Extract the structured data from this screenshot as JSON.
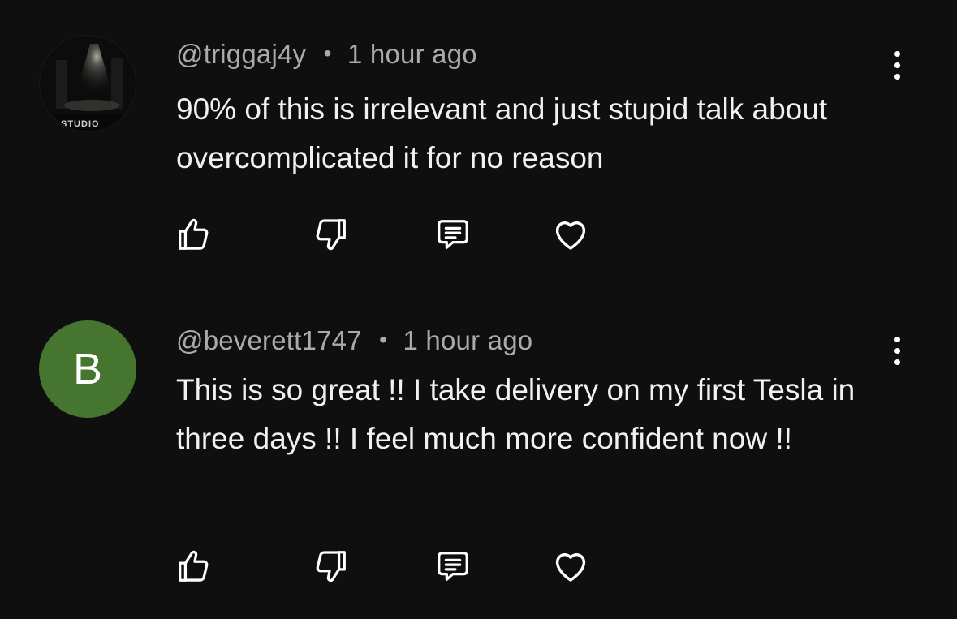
{
  "comments": [
    {
      "username": "@triggaj4y",
      "separator": "•",
      "time": "1 hour ago",
      "text": "90% of this is irrelevant and just stupid talk about overcomplicated it for no reason",
      "avatar": {
        "type": "photo",
        "caption": "STUDIO"
      }
    },
    {
      "username": "@beverett1747",
      "separator": "•",
      "time": "1 hour ago",
      "text": "This is so great !! I take delivery on my first Tesla in three days !! I feel much more confident now !!",
      "avatar": {
        "type": "letter",
        "letter": "B",
        "color": "#467530"
      }
    }
  ],
  "icons": {
    "like": "thumbs-up-icon",
    "dislike": "thumbs-down-icon",
    "reply": "reply-comment-icon",
    "heart": "heart-icon",
    "menu": "more-vertical-icon"
  },
  "colors": {
    "background": "#0f0f0f",
    "text": "#f1f1f1",
    "meta": "#aaaaaa",
    "avatar_green": "#467530"
  }
}
